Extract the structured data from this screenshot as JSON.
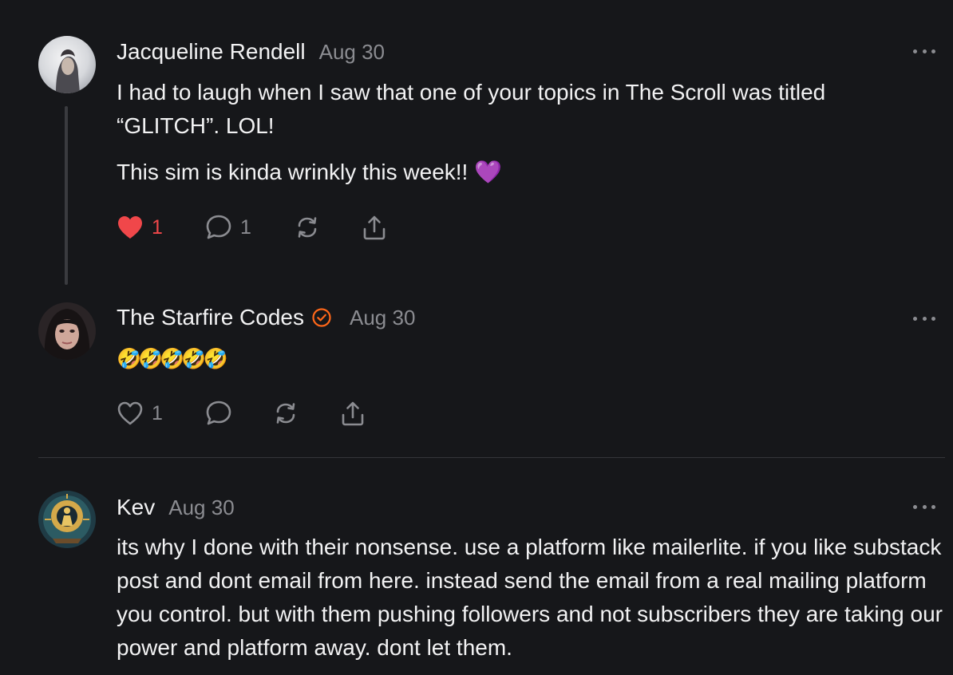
{
  "comments": [
    {
      "author": "Jacqueline Rendell",
      "date": "Aug 30",
      "verified": false,
      "paragraphs": [
        "I had to laugh when I saw that one of your topics in The Scroll was titled “GLITCH”. LOL!",
        "This sim is kinda wrinkly this week!! 💜"
      ],
      "likes": "1",
      "liked": true,
      "replies": "1"
    },
    {
      "author": "The Starfire Codes",
      "date": "Aug 30",
      "verified": true,
      "paragraphs": [
        "🤣🤣🤣🤣🤣"
      ],
      "likes": "1",
      "liked": false,
      "replies": ""
    },
    {
      "author": "Kev",
      "date": "Aug 30",
      "verified": false,
      "paragraphs": [
        "its why I done with their nonsense. use a platform like mailerlite. if you like substack post and dont email from here. instead send the email from a real mailing platform you control. but with them pushing followers and not subscribers they are taking our power and platform away. dont let them."
      ]
    }
  ],
  "icons": {
    "heart": "heart-icon",
    "comment": "comment-icon",
    "restack": "restack-icon",
    "share": "share-icon",
    "more": "more-options-icon",
    "verified": "verified-badge-icon"
  },
  "colors": {
    "background": "#16171a",
    "text": "#f2f2f3",
    "muted": "#8b8c91",
    "like": "#f0474a",
    "verified": "#ff6719"
  }
}
